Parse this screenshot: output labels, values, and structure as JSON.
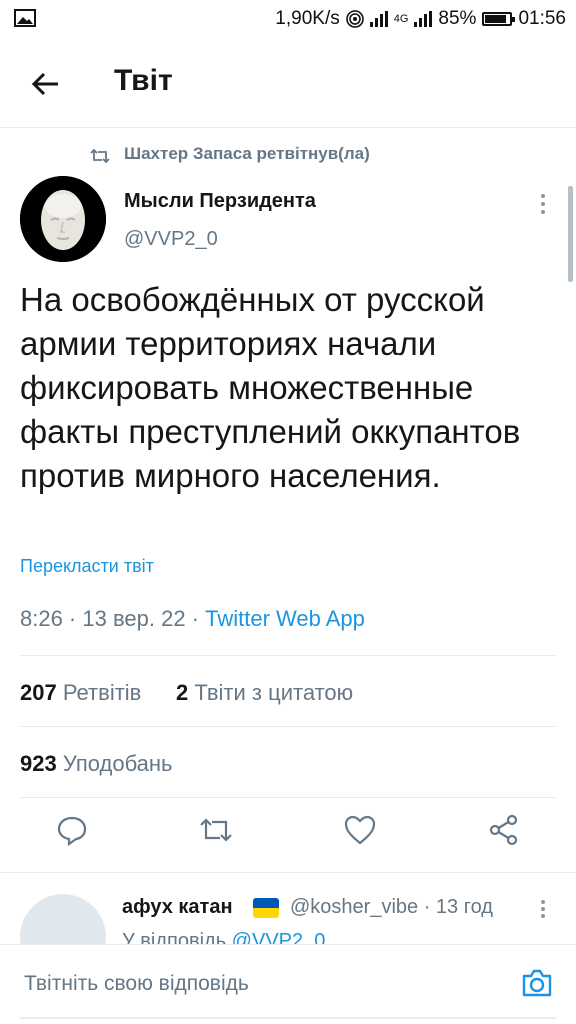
{
  "status_bar": {
    "speed": "1,90K/s",
    "network": "4G",
    "battery": "85%",
    "battery_level": 0.85,
    "time": "01:56"
  },
  "header": {
    "title": "Твіт"
  },
  "retweet": {
    "text": "Шахтер Запаса ретвітнув(ла)"
  },
  "tweet": {
    "name": "Мысли Перзидента",
    "handle": "@VVP2_0",
    "text": "На освобождённых от русской армии территориях начали фиксировать множественные факты преступлений оккупантов против мирного населения.",
    "translate": "Перекласти твіт",
    "time": "8:26 · 13 вер. 22 · ",
    "app": "Twitter Web App"
  },
  "stats": {
    "retweets_count": "207",
    "retweets_label": "Ретвітів",
    "quotes_count": "2",
    "quotes_label": "Твіти з цитатою",
    "likes_count": "923",
    "likes_label": "Уподобань"
  },
  "actions": [
    "reply-icon",
    "retweet-icon",
    "like-icon",
    "share-icon"
  ],
  "reply": {
    "name": "афух катан",
    "handle": "@kosher_vibe · 13 год",
    "replying_prefix": "У відповідь ",
    "replying_handle": "@VVP2_0"
  },
  "composer": {
    "placeholder": "Твітніть свою відповідь"
  },
  "colors": {
    "accent": "#1b95e0",
    "secondary": "#657786",
    "text": "#14171a"
  }
}
